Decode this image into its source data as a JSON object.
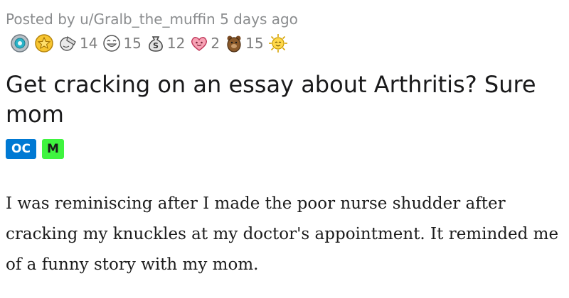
{
  "post": {
    "meta": "Posted by u/Gralb_the_muffin 5 days ago",
    "awards": [
      {
        "icon": "silver-badge-icon",
        "count": ""
      },
      {
        "icon": "gold-star-icon",
        "count": ""
      },
      {
        "icon": "facepalm-icon",
        "count": "14"
      },
      {
        "icon": "laughing-face-icon",
        "count": "15"
      },
      {
        "icon": "money-bag-icon",
        "count": "12"
      },
      {
        "icon": "heart-face-icon",
        "count": "2"
      },
      {
        "icon": "bear-icon",
        "count": "15"
      },
      {
        "icon": "sun-face-icon",
        "count": ""
      }
    ],
    "title": "Get cracking on an essay about Arthritis? Sure mom",
    "flairs": {
      "oc": "OC",
      "m": "M"
    },
    "body": "I was reminiscing after I made the poor nurse shudder after cracking my knuckles at my doctor's appointment. It reminded me of a funny story with my mom."
  },
  "colors": {
    "oc_flair": "#0079d3",
    "m_flair": "#3ff43f",
    "meta_text": "#8a8c8e"
  }
}
